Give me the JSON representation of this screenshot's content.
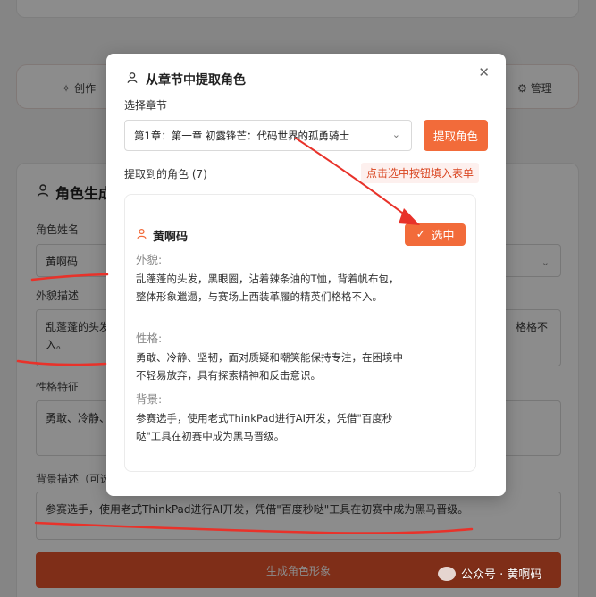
{
  "background": {
    "tabs": {
      "create": "创作",
      "manage": "管理"
    },
    "panel_title": "角色生成",
    "name_label": "角色姓名",
    "name_value": "黄啊码",
    "appearance_label": "外貌描述",
    "appearance_left": "乱蓬蓬的头发",
    "appearance_left2": "入。",
    "appearance_right": "格格不",
    "personality_label": "性格特征",
    "personality_value": "勇敢、冷静、",
    "background_label": "背景描述（可选",
    "background_value": "参赛选手，使用老式ThinkPad进行AI开发，凭借\"百度秒哒\"工具在初赛中成为黑马晋级。",
    "generate_button": "生成角色形象"
  },
  "modal": {
    "title": "从章节中提取角色",
    "chapter_label": "选择章节",
    "chapter_value": "第1章：第一章 初露锋芒：代码世界的孤勇骑士",
    "extract_button": "提取角色",
    "extracted_label": "提取到的角色 (7)",
    "annotation": "点击选中按钮填入表单",
    "character": {
      "name": "黄啊码",
      "select_button": "选中",
      "appearance_label": "外貌:",
      "appearance": "乱蓬蓬的头发，黑眼圈，沾着辣条油的T恤，背着帆布包，整体形象邋遢，与赛场上西装革履的精英们格格不入。",
      "personality_label": "性格:",
      "personality": "勇敢、冷静、坚韧，面对质疑和嘲笑能保持专注，在困境中不轻易放弃，具有探索精神和反击意识。",
      "background_label": "背景:",
      "background": "参赛选手，使用老式ThinkPad进行AI开发，凭借\"百度秒哒\"工具在初赛中成为黑马晋级。"
    }
  },
  "watermark": "公众号 · 黄啊码",
  "colors": {
    "accent": "#f26b3a",
    "annotation_red": "#e8322a"
  }
}
